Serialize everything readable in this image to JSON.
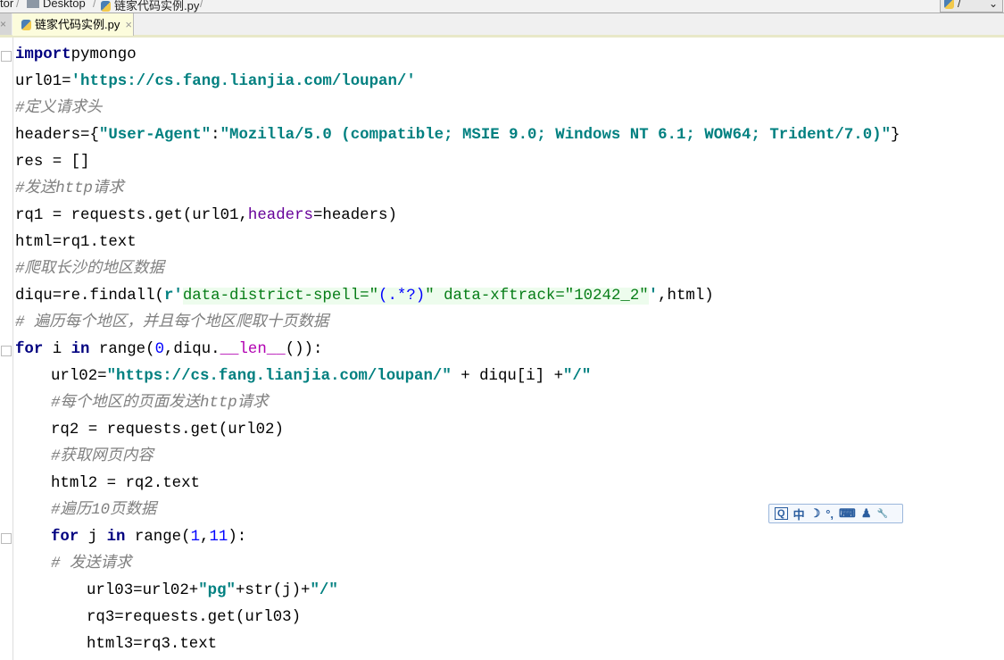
{
  "breadcrumb": {
    "items": [
      "tor",
      "Desktop",
      "链家代码实例.py"
    ]
  },
  "combo": {
    "value": "/"
  },
  "tabs": [
    {
      "label": "链家代码实例.py",
      "close": "×"
    }
  ],
  "ime_toolbar": {
    "items": [
      "Q",
      "中",
      "☽",
      "°,",
      "⌨",
      "♟",
      "🔧"
    ]
  },
  "code": [
    {
      "indent": 0,
      "fold": true,
      "tokens": [
        [
          "kw",
          "import"
        ],
        [
          "",
          "pymongo"
        ]
      ]
    },
    {
      "indent": 0,
      "tokens": [
        [
          "",
          "url01="
        ],
        [
          "str",
          "'https://cs.fang.lianjia.com/loupan/'"
        ]
      ]
    },
    {
      "indent": 0,
      "tokens": [
        [
          "com",
          "#定义请求头"
        ]
      ]
    },
    {
      "indent": 0,
      "tokens": [
        [
          "",
          "headers={"
        ],
        [
          "str",
          "\"User-Agent\""
        ],
        [
          "",
          ":"
        ],
        [
          "str",
          "\"Mozilla/5.0 (compatible; MSIE 9.0; Windows NT 6.1; WOW64; Trident/7.0)\""
        ],
        [
          "",
          "}"
        ]
      ]
    },
    {
      "indent": 0,
      "tokens": [
        [
          "",
          "res = []"
        ]
      ]
    },
    {
      "indent": 0,
      "tokens": [
        [
          "com",
          "#发送http请求"
        ]
      ]
    },
    {
      "indent": 0,
      "tokens": [
        [
          "",
          "rq1 = requests.get(url01,"
        ],
        [
          "kwarg",
          "headers"
        ],
        [
          "",
          "=headers)"
        ]
      ]
    },
    {
      "indent": 0,
      "tokens": [
        [
          "",
          "html=rq1.text"
        ]
      ]
    },
    {
      "indent": 0,
      "tokens": [
        [
          "com",
          "#爬取长沙的地区数据"
        ]
      ]
    },
    {
      "indent": 0,
      "tokens": [
        [
          "",
          "diqu=re.findall("
        ],
        [
          "str",
          "r'"
        ],
        [
          "rx",
          "data-district-spell=\""
        ],
        [
          "rxs",
          "(.*?)"
        ],
        [
          "rx",
          "\" data-xftrack=\"10242_2\""
        ],
        [
          "str",
          "'"
        ],
        [
          "",
          ",html)"
        ]
      ]
    },
    {
      "indent": 0,
      "tokens": [
        [
          "com",
          "# 遍历每个地区，并且每个地区爬取十页数据"
        ]
      ]
    },
    {
      "indent": 0,
      "fold": true,
      "tokens": [
        [
          "kw",
          "for"
        ],
        [
          "",
          " i "
        ],
        [
          "kw",
          "in"
        ],
        [
          "",
          " range("
        ],
        [
          "num",
          "0"
        ],
        [
          "",
          ",diqu."
        ],
        [
          "magic",
          "__len__"
        ],
        [
          "",
          "()):"
        ]
      ]
    },
    {
      "indent": 1,
      "tokens": [
        [
          "",
          "url02="
        ],
        [
          "str",
          "\"https://cs.fang.lianjia.com/loupan/\""
        ],
        [
          "",
          " + diqu[i] +"
        ],
        [
          "str",
          "\"/\""
        ]
      ]
    },
    {
      "indent": 1,
      "tokens": [
        [
          "com",
          "#每个地区的页面发送http请求"
        ]
      ]
    },
    {
      "indent": 1,
      "tokens": [
        [
          "",
          "rq2 = requests.get(url02)"
        ]
      ]
    },
    {
      "indent": 1,
      "tokens": [
        [
          "com",
          "#获取网页内容"
        ]
      ]
    },
    {
      "indent": 1,
      "tokens": [
        [
          "",
          "html2 = rq2.text"
        ]
      ]
    },
    {
      "indent": 1,
      "tokens": [
        [
          "com",
          "#遍历10页数据"
        ]
      ]
    },
    {
      "indent": 1,
      "fold": true,
      "tokens": [
        [
          "kw",
          "for"
        ],
        [
          "",
          " j "
        ],
        [
          "kw",
          "in"
        ],
        [
          "",
          " range("
        ],
        [
          "num",
          "1"
        ],
        [
          "",
          ","
        ],
        [
          "num",
          "11"
        ],
        [
          "",
          "):"
        ]
      ]
    },
    {
      "indent": 1,
      "tokens": [
        [
          "com",
          "# 发送请求"
        ]
      ]
    },
    {
      "indent": 2,
      "tokens": [
        [
          "",
          "url03=url02+"
        ],
        [
          "str",
          "\"pg\""
        ],
        [
          "",
          "+str(j)+"
        ],
        [
          "str",
          "\"/\""
        ]
      ]
    },
    {
      "indent": 2,
      "tokens": [
        [
          "",
          "rq3=requests.get(url03)"
        ]
      ]
    },
    {
      "indent": 2,
      "tokens": [
        [
          "",
          "html3=rq3.text"
        ]
      ]
    }
  ]
}
